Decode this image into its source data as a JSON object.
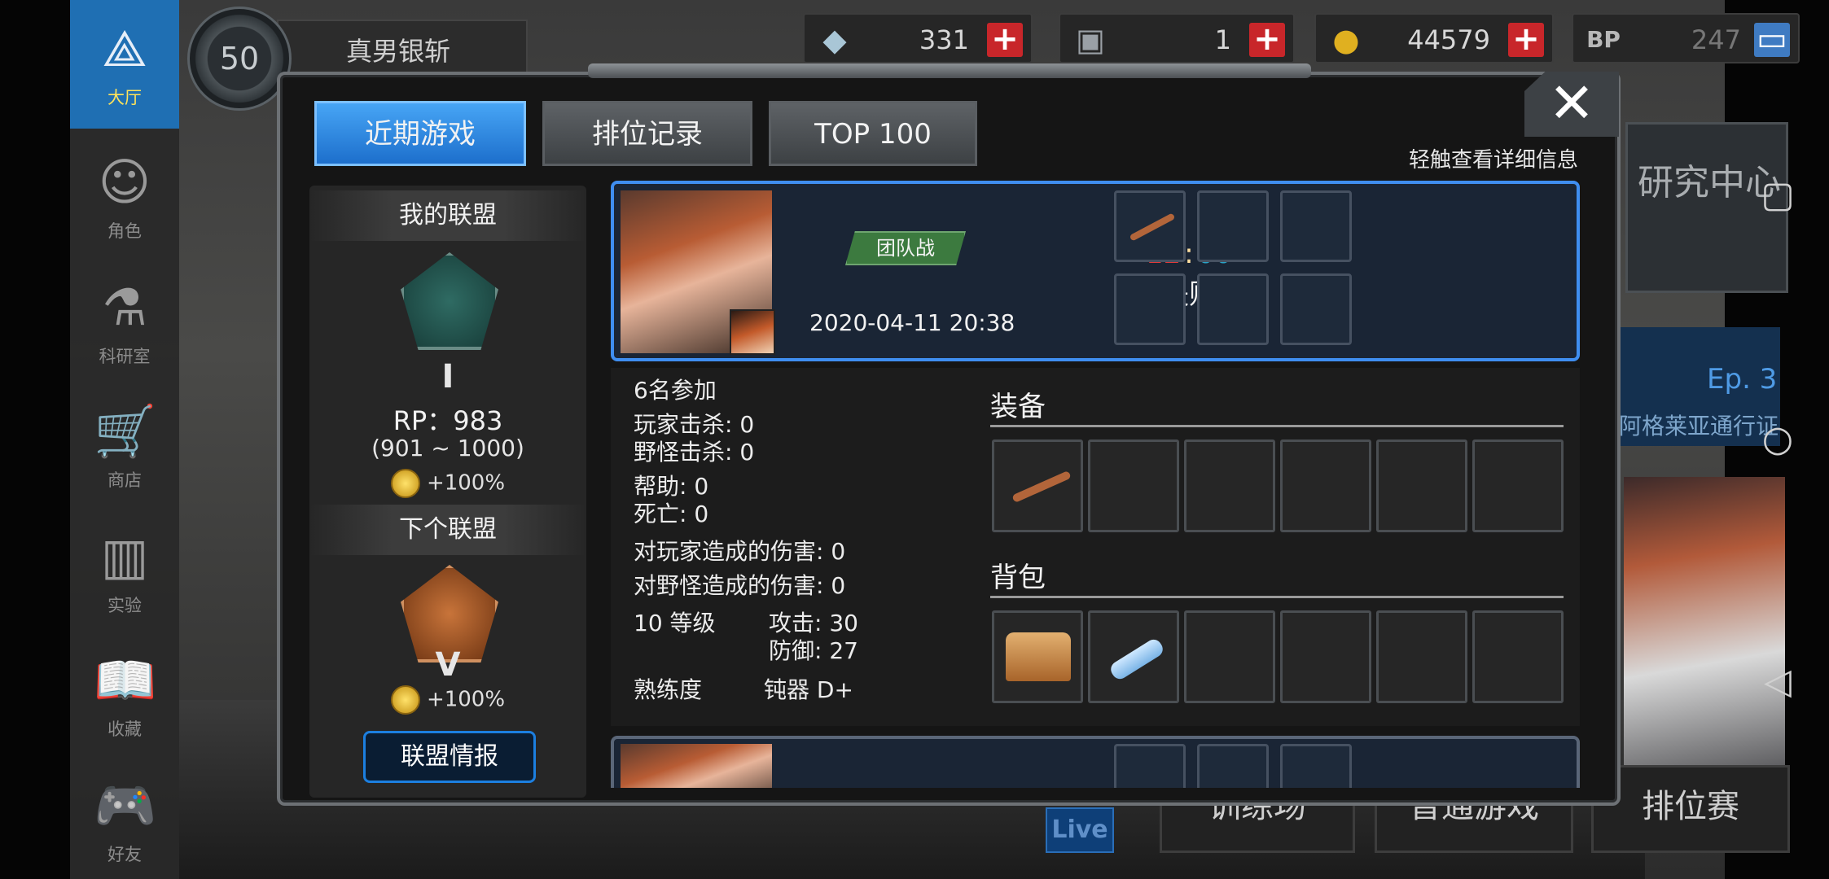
{
  "nav": {
    "items": [
      {
        "label": "大厅",
        "icon": "lobby-icon",
        "glyph": "⟁"
      },
      {
        "label": "角色",
        "icon": "character-icon",
        "glyph": "☺"
      },
      {
        "label": "科研室",
        "icon": "lab-flask-icon",
        "glyph": "⚗"
      },
      {
        "label": "商店",
        "icon": "shop-cart-icon",
        "glyph": "🛒"
      },
      {
        "label": "实验",
        "icon": "books-icon",
        "glyph": "▥"
      },
      {
        "label": "收藏",
        "icon": "open-book-icon",
        "glyph": "📖"
      },
      {
        "label": "好友",
        "icon": "gamepad-icon",
        "glyph": "🎮"
      }
    ]
  },
  "topbar": {
    "level": "50",
    "player_name": "真男银斩",
    "resources": [
      {
        "icon": "crystal-icon",
        "value": "331"
      },
      {
        "icon": "hard-drive-icon",
        "value": "1"
      },
      {
        "icon": "gold-coin-icon",
        "value": "44579"
      },
      {
        "icon": "bp-paw-icon",
        "value": "247"
      }
    ]
  },
  "modal": {
    "tabs": [
      "近期游戏",
      "排位记录",
      "TOP 100"
    ],
    "hint": "轻触查看详细信息",
    "close": "✕"
  },
  "alliance": {
    "my_title": "我的联盟",
    "my_rank_letter": "I",
    "rp": "RP：983",
    "rp_range": "(901 ~ 1000)",
    "my_bonus": "+100%",
    "next_title": "下个联盟",
    "next_rank_letter": "V",
    "next_bonus": "+100%",
    "info_button": "联盟情报"
  },
  "match": {
    "mode": "团队战",
    "datetime": "2020-04-11 20:38",
    "kills": "12",
    "separator": ":",
    "time": "00",
    "result": "失败"
  },
  "detail": {
    "participants": "6名参加",
    "player_kills": "玩家击杀: 0",
    "monster_kills": "野怪击杀: 0",
    "assists": "帮助: 0",
    "deaths": "死亡: 0",
    "dmg_players": "对玩家造成的伤害: 0",
    "dmg_monsters": "对野怪造成的伤害: 0",
    "level": "10 等级",
    "attack": "攻击: 30",
    "defense": "防御: 27",
    "proficiency_label": "熟练度",
    "proficiency_value": "钝器 D+",
    "equip_title": "装备",
    "bag_title": "背包"
  },
  "bottom": {
    "training": "训练场",
    "normal": "普通游戏",
    "ranked": "排位赛",
    "live": "Live"
  },
  "right_side": {
    "research": "研究中心",
    "episode": "Ep. 3",
    "pass": "阿格莱亚通行证"
  },
  "colors": {
    "accent_blue": "#1f6fb3",
    "tab_active": "#2f8ae6",
    "kills_red": "#e03a3a",
    "time_cyan": "#2aa4c8",
    "mode_green": "#3c7a3f"
  }
}
